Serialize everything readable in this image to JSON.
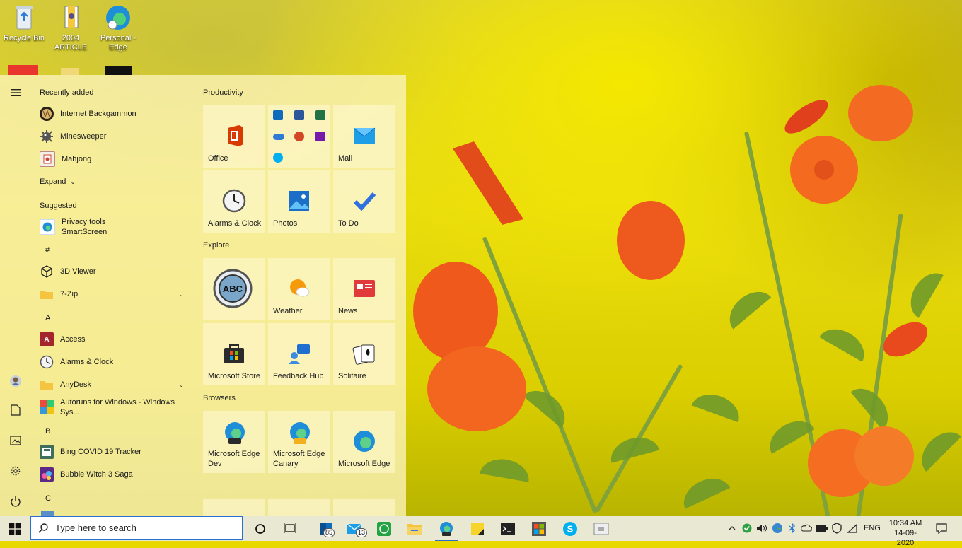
{
  "desktop": {
    "icons": [
      {
        "label": "Recycle Bin"
      },
      {
        "label": "2004 ARTICLE"
      },
      {
        "label": "Personal - Edge"
      }
    ]
  },
  "start_menu": {
    "recently_added_label": "Recently added",
    "recent_apps": [
      "Internet Backgammon",
      "Minesweeper",
      "Mahjong"
    ],
    "expand_label": "Expand",
    "suggested_label": "Suggested",
    "suggested_app": {
      "line1": "Privacy tools",
      "line2": "SmartScreen"
    },
    "letters": {
      "hash": "#",
      "a": "A",
      "b": "B",
      "c": "C"
    },
    "hash_apps": [
      "3D Viewer",
      "7-Zip"
    ],
    "a_apps": [
      "Access",
      "Alarms & Clock",
      "AnyDesk",
      "Autoruns for Windows - Windows Sys..."
    ],
    "b_apps": [
      "Bing COVID 19 Tracker",
      "Bubble Witch 3 Saga"
    ],
    "groups": {
      "productivity": "Productivity",
      "explore": "Explore",
      "browsers": "Browsers"
    },
    "tiles": {
      "office": "Office",
      "mail": "Mail",
      "alarms": "Alarms & Clock",
      "photos": "Photos",
      "todo": "To Do",
      "weather": "Weather",
      "news": "News",
      "store": "Microsoft Store",
      "feedback": "Feedback Hub",
      "solitaire": "Solitaire",
      "edge_dev": "Microsoft Edge Dev",
      "edge_canary": "Microsoft Edge Canary",
      "edge": "Microsoft Edge"
    }
  },
  "taskbar": {
    "search_placeholder": "Type here to search",
    "badges": {
      "outlook": "85",
      "mail": "13"
    },
    "lang": "ENG",
    "time": "10:34 AM",
    "date": "14-09-2020"
  },
  "colors": {
    "accent": "#2a6fd0",
    "start_bg": "#faf2b4",
    "taskbar": "#e9e8d2"
  }
}
